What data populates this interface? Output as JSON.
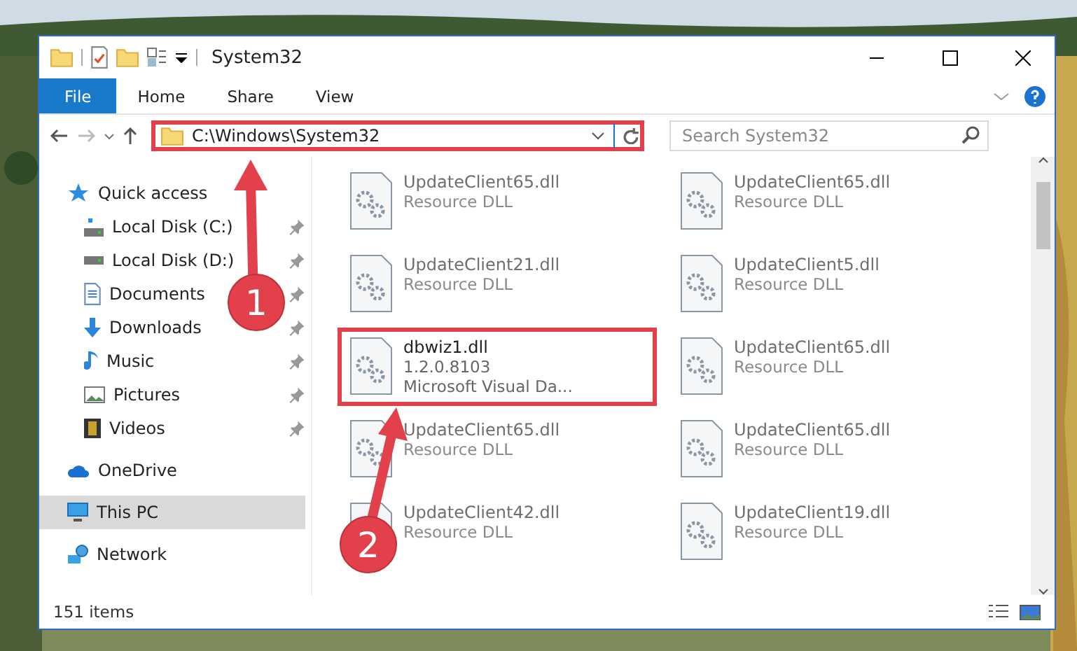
{
  "window": {
    "title": "System32"
  },
  "ribbon_tabs": [
    {
      "label": "File",
      "selected": true
    },
    {
      "label": "Home",
      "selected": false
    },
    {
      "label": "Share",
      "selected": false
    },
    {
      "label": "View",
      "selected": false
    }
  ],
  "address": {
    "path": "C:\\Windows\\System32",
    "highlighted": true
  },
  "search": {
    "placeholder": "Search System32"
  },
  "sidebar": {
    "items": [
      {
        "label": "Quick access",
        "pinned": false,
        "selected": false,
        "group": true
      },
      {
        "label": "Local Disk (C:)",
        "pinned": true,
        "selected": false,
        "group": false
      },
      {
        "label": "Local Disk (D:)",
        "pinned": true,
        "selected": false,
        "group": false
      },
      {
        "label": "Documents",
        "pinned": true,
        "selected": false,
        "group": false
      },
      {
        "label": "Downloads",
        "pinned": true,
        "selected": false,
        "group": false
      },
      {
        "label": "Music",
        "pinned": true,
        "selected": false,
        "group": false
      },
      {
        "label": "Pictures",
        "pinned": true,
        "selected": false,
        "group": false
      },
      {
        "label": "Videos",
        "pinned": true,
        "selected": false,
        "group": false
      },
      {
        "label": "OneDrive",
        "pinned": false,
        "selected": false,
        "group": true
      },
      {
        "label": "This PC",
        "pinned": false,
        "selected": true,
        "group": true
      },
      {
        "label": "Network",
        "pinned": false,
        "selected": false,
        "group": true
      }
    ]
  },
  "files": [
    {
      "name": "UpdateClient65.dll",
      "lines": [
        "Resource DLL"
      ],
      "blurred": true,
      "highlighted": false
    },
    {
      "name": "UpdateClient65.dll",
      "lines": [
        "Resource DLL"
      ],
      "blurred": true,
      "highlighted": false
    },
    {
      "name": "UpdateClient21.dll",
      "lines": [
        "Resource DLL"
      ],
      "blurred": true,
      "highlighted": false
    },
    {
      "name": "UpdateClient5.dll",
      "lines": [
        "Resource DLL"
      ],
      "blurred": true,
      "highlighted": false
    },
    {
      "name": "dbwiz1.dll",
      "lines": [
        "1.2.0.8103",
        "Microsoft Visual Da..."
      ],
      "blurred": false,
      "highlighted": true
    },
    {
      "name": "UpdateClient65.dll",
      "lines": [
        "Resource DLL"
      ],
      "blurred": true,
      "highlighted": false
    },
    {
      "name": "UpdateClient65.dll",
      "lines": [
        "Resource DLL"
      ],
      "blurred": true,
      "highlighted": false
    },
    {
      "name": "UpdateClient65.dll",
      "lines": [
        "Resource DLL"
      ],
      "blurred": true,
      "highlighted": false
    },
    {
      "name": "UpdateClient42.dll",
      "lines": [
        "Resource DLL"
      ],
      "blurred": true,
      "highlighted": false
    },
    {
      "name": "UpdateClient19.dll",
      "lines": [
        "Resource DLL"
      ],
      "blurred": true,
      "highlighted": false
    }
  ],
  "status_bar": {
    "count": "151 items"
  },
  "callouts": [
    {
      "number": "1"
    },
    {
      "number": "2"
    }
  ]
}
